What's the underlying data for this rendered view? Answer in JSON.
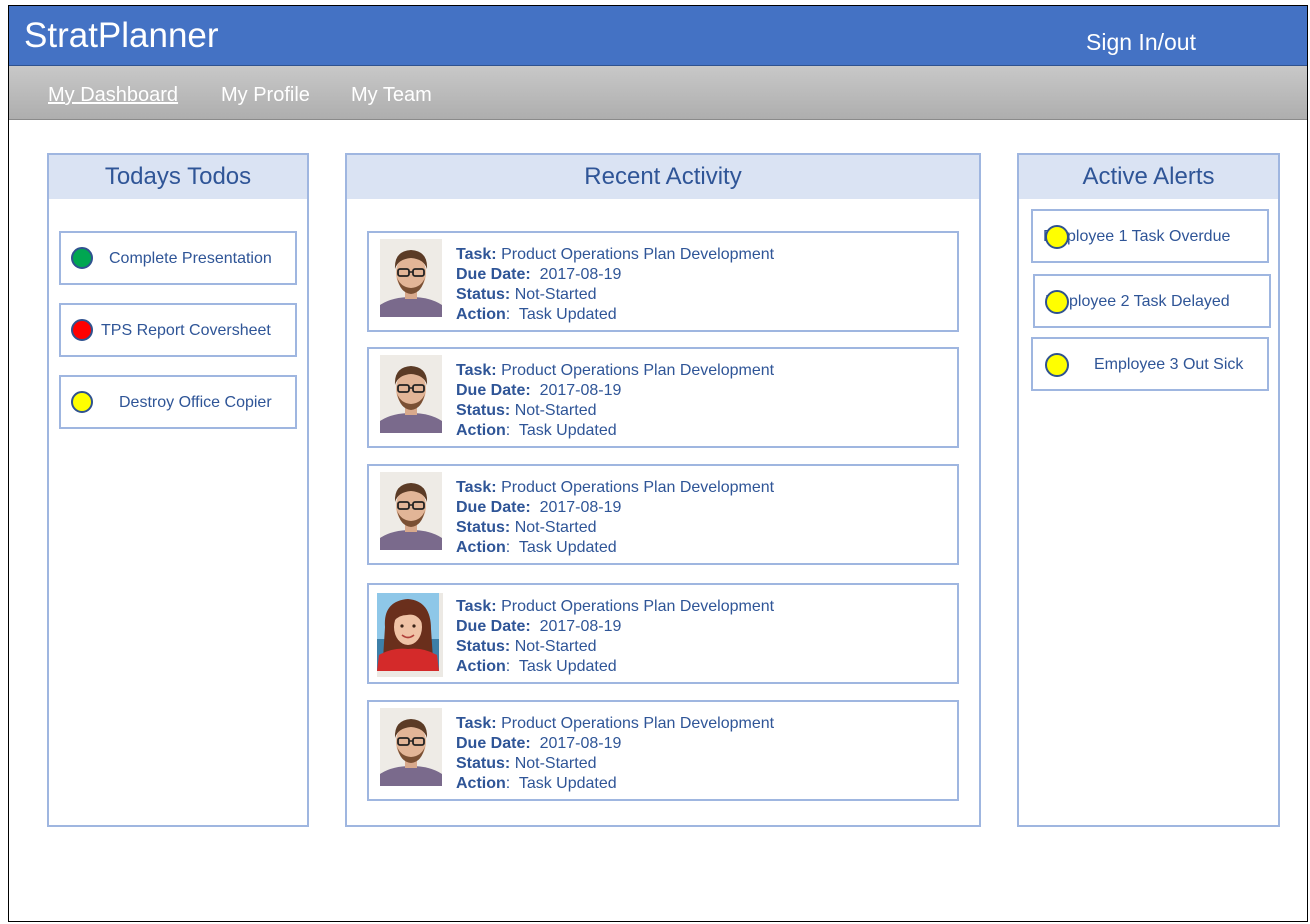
{
  "app": {
    "title": "StratPlanner",
    "sign_in_label": "Sign In/out"
  },
  "nav": {
    "items": [
      {
        "label": "My Dashboard",
        "active": true
      },
      {
        "label": "My Profile",
        "active": false
      },
      {
        "label": "My Team",
        "active": false
      }
    ]
  },
  "todos": {
    "title": "Todays Todos",
    "items": [
      {
        "label": "Complete Presentation",
        "status_color": "#00a651"
      },
      {
        "label": "TPS Report Coversheet",
        "status_color": "#ff0000"
      },
      {
        "label": "Destroy Office Copier",
        "status_color": "#ffff00"
      }
    ]
  },
  "activity": {
    "title": "Recent Activity",
    "field_labels": {
      "task": "Task:",
      "due_date": "Due Date:",
      "status": "Status:",
      "action": "Action"
    },
    "items": [
      {
        "avatar": "male-avatar",
        "task": "Product Operations Plan Development",
        "due_date": "2017-08-19",
        "status": "Not-Started",
        "action": "Task Updated"
      },
      {
        "avatar": "male-avatar",
        "task": "Product Operations Plan Development",
        "due_date": "2017-08-19",
        "status": "Not-Started",
        "action": "Task Updated"
      },
      {
        "avatar": "male-avatar",
        "task": "Product Operations Plan Development",
        "due_date": "2017-08-19",
        "status": "Not-Started",
        "action": "Task Updated"
      },
      {
        "avatar": "female-avatar",
        "task": "Product Operations Plan Development",
        "due_date": "2017-08-19",
        "status": "Not-Started",
        "action": "Task Updated"
      },
      {
        "avatar": "male-avatar",
        "task": "Product Operations Plan Development",
        "due_date": "2017-08-19",
        "status": "Not-Started",
        "action": "Task Updated"
      }
    ]
  },
  "alerts": {
    "title": "Active Alerts",
    "items": [
      {
        "label": "Employee 1 Task Overdue",
        "status_color": "#ffff00"
      },
      {
        "label": "Employee 2 Task Delayed",
        "status_color": "#ffff00"
      },
      {
        "label": "Employee 3 Out Sick",
        "status_color": "#ffff00"
      }
    ]
  },
  "colors": {
    "header_blue": "#4472c4",
    "text_blue": "#2f5597",
    "panel_border": "#9fb6e0",
    "panel_header_bg": "#dae3f3"
  }
}
